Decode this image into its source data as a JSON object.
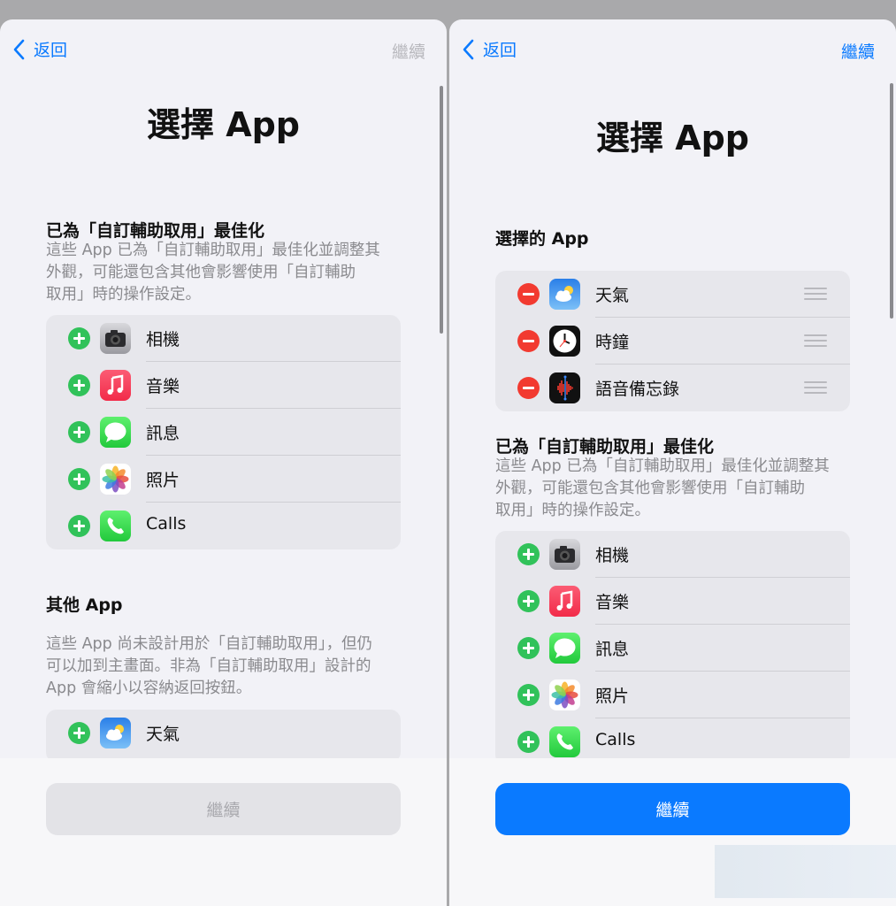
{
  "nav": {
    "back": "返回",
    "continue": "繼續"
  },
  "title": "選擇 App",
  "optimized_section": {
    "heading": "已為「自訂輔助取用」最佳化",
    "desc_lines": [
      "這些 App 已為「自訂輔助取用」最佳化並調整其",
      "外觀，可能還包含其他會影響使用「自訂輔助",
      "取用」時的操作設定。"
    ],
    "apps": [
      "相機",
      "音樂",
      "訊息",
      "照片",
      "Calls"
    ]
  },
  "other_section": {
    "heading": "其他 App",
    "desc_lines": [
      "這些 App 尚未設計用於「自訂輔助取用」，但仍",
      "可以加到主畫面。非為「自訂輔助取用」設計的",
      "App 會縮小以容納返回按鈕。"
    ],
    "apps": [
      "天氣"
    ]
  },
  "selected_section": {
    "heading": "選擇的 App",
    "apps": [
      "天氣",
      "時鐘",
      "語音備忘錄"
    ]
  },
  "bottom_button": "繼續",
  "colors": {
    "accent": "#0a7aff",
    "add": "#31c25a",
    "remove": "#f23a30"
  }
}
